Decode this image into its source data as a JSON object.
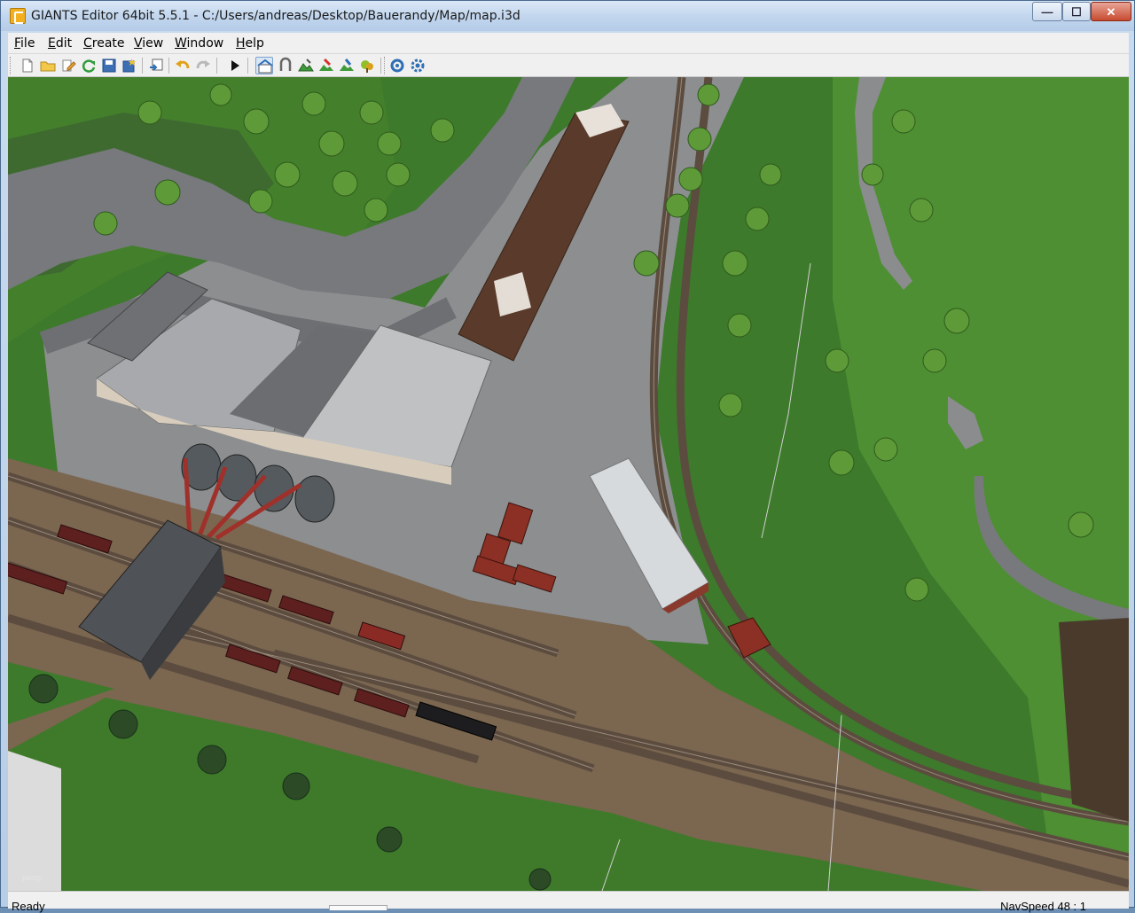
{
  "window": {
    "title": "GIANTS Editor 64bit 5.5.1 - C:/Users/andreas/Desktop/Bauerandy/Map/map.i3d",
    "min_glyph": "—",
    "max_glyph": "☐",
    "close_glyph": "✕"
  },
  "menu": {
    "items": [
      {
        "first": "F",
        "rest": "ile"
      },
      {
        "first": "E",
        "rest": "dit"
      },
      {
        "first": "C",
        "rest": "reate"
      },
      {
        "first": "V",
        "rest": "iew"
      },
      {
        "first": "W",
        "rest": "indow"
      },
      {
        "first": "H",
        "rest": "elp"
      }
    ]
  },
  "toolbar": {
    "buttons": [
      {
        "icon": "new-file-icon"
      },
      {
        "icon": "open-folder-icon"
      },
      {
        "icon": "edit-script-icon"
      },
      {
        "icon": "reload-icon"
      },
      {
        "icon": "save-icon"
      },
      {
        "icon": "save-as-icon"
      },
      {
        "icon": "import-icon"
      },
      {
        "icon": "undo-icon"
      },
      {
        "icon": "redo-icon"
      },
      {
        "icon": "play-icon"
      },
      {
        "icon": "select-mode-icon"
      },
      {
        "icon": "move-mode-icon"
      },
      {
        "icon": "terrain-sculpt-icon"
      },
      {
        "icon": "terrain-paint-icon"
      },
      {
        "icon": "foliage-paint-icon"
      },
      {
        "icon": "placement-icon"
      },
      {
        "icon": "rotate-camera-icon"
      },
      {
        "icon": "settings-icon"
      }
    ],
    "accent": "#2f6fb5"
  },
  "viewport": {
    "camera_label": "persp",
    "colors": {
      "grass": "#3f7a2a",
      "gravel": "#8a8c8e",
      "dirt": "#7a6450",
      "road": "#6e7073"
    }
  },
  "status": {
    "left": "Ready",
    "right": "NavSpeed 48 : 1"
  }
}
